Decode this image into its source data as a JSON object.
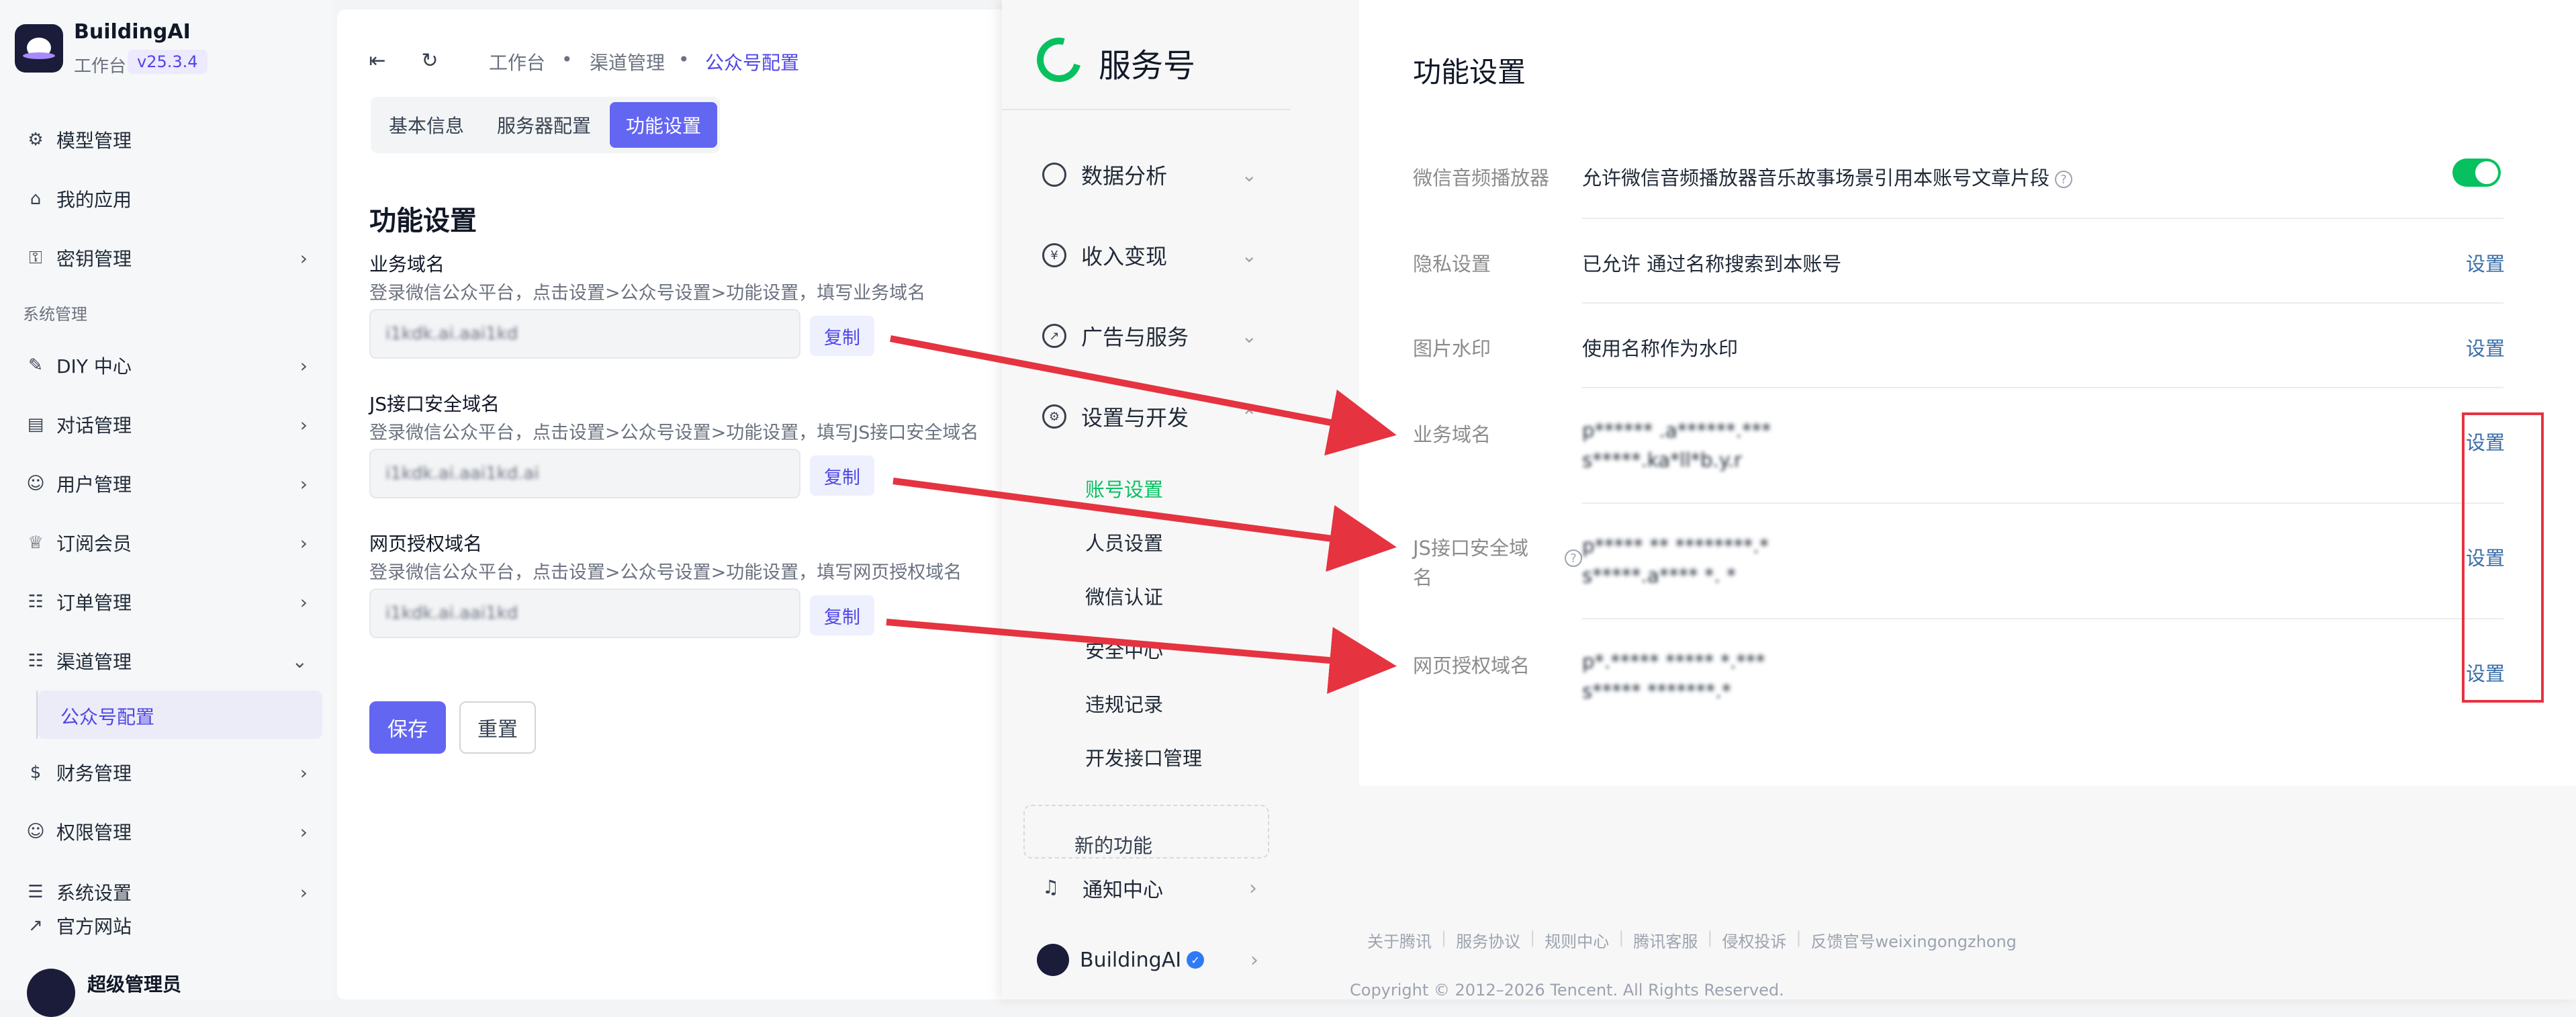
{
  "app": {
    "brand": "BuildingAI",
    "workspace": "工作台",
    "version": "v25.3.4"
  },
  "sidebar": {
    "items": [
      {
        "label": "模型管理",
        "icon": "model-icon"
      },
      {
        "label": "我的应用",
        "icon": "store-icon"
      },
      {
        "label": "密钥管理",
        "icon": "key-icon"
      }
    ],
    "section": "系统管理",
    "system_items": [
      {
        "label": "DIY 中心",
        "icon": "brush-icon"
      },
      {
        "label": "对话管理",
        "icon": "chat-icon"
      },
      {
        "label": "用户管理",
        "icon": "users-icon"
      },
      {
        "label": "订阅会员",
        "icon": "crown-icon"
      },
      {
        "label": "订单管理",
        "icon": "clipboard-icon"
      },
      {
        "label": "渠道管理",
        "icon": "channel-icon"
      }
    ],
    "channel_sub": "公众号配置",
    "more_items": [
      {
        "label": "财务管理",
        "icon": "finance-icon"
      },
      {
        "label": "权限管理",
        "icon": "permission-icon"
      },
      {
        "label": "系统设置",
        "icon": "settings-icon"
      }
    ],
    "website": "官方网站",
    "user": "超级管理员"
  },
  "config": {
    "breadcrumb": [
      "工作台",
      "渠道管理",
      "公众号配置"
    ],
    "tabs": [
      "基本信息",
      "服务器配置",
      "功能设置"
    ],
    "active_tab": "功能设置",
    "title": "功能设置",
    "fields": [
      {
        "label": "业务域名",
        "help": "登录微信公众平台，点击设置>公众号设置>功能设置，填写业务域名",
        "value": "i1kdk.ai.aai1kd"
      },
      {
        "label": "JS接口安全域名",
        "help": "登录微信公众平台，点击设置>公众号设置>功能设置，填写JS接口安全域名",
        "value": "i1kdk.ai.aai1kd.ai"
      },
      {
        "label": "网页授权域名",
        "help": "登录微信公众平台，点击设置>公众号设置>功能设置，填写网页授权域名",
        "value": "i1kdk.ai.aai1kd"
      }
    ],
    "copy_label": "复制",
    "save_label": "保存",
    "reset_label": "重置"
  },
  "wechat": {
    "title": "服务号",
    "menu": [
      {
        "label": "数据分析",
        "icon": "analytics-icon"
      },
      {
        "label": "收入变现",
        "icon": "yen-icon"
      },
      {
        "label": "广告与服务",
        "icon": "compass-icon"
      },
      {
        "label": "设置与开发",
        "icon": "gear-icon"
      }
    ],
    "submenu": [
      "账号设置",
      "人员设置",
      "微信认证",
      "安全中心",
      "违规记录",
      "开发接口管理"
    ],
    "active_sub": "账号设置",
    "new_feature": "新的功能",
    "notify": "通知中心",
    "account": "BuildingAI",
    "content_title": "功能设置",
    "rows": [
      {
        "label": "微信音频播放器",
        "value": "允许微信音频播放器音乐故事场景引用本账号文章片段"
      },
      {
        "label": "隐私设置",
        "value": "已允许 通过名称搜索到本账号",
        "link": "设置"
      },
      {
        "label": "图片水印",
        "value": "使用名称作为水印",
        "link": "设置"
      },
      {
        "label": "业务域名",
        "value1": "p****** .a******.*** ",
        "value2": "s*****.ka*ll*b.y.r",
        "link": "设置"
      },
      {
        "label": "JS接口安全域名",
        "value1": "p***** ** ********.*",
        "value2": "s*****.a**** *. *",
        "link": "设置"
      },
      {
        "label": "网页授权域名",
        "value1": "p*.***** ***** *.***",
        "value2": "s***** *******.*",
        "link": "设置"
      }
    ],
    "audio_toggle": true,
    "footer": [
      "关于腾讯",
      "服务协议",
      "规则中心",
      "腾讯客服",
      "侵权投诉",
      "反馈官号weixingongzhong"
    ],
    "copyright": "Copyright © 2012–2026 Tencent. All Rights Reserved."
  },
  "colors": {
    "accent": "#6366f1",
    "wechat_green": "#07c160",
    "annotation_red": "#e53340"
  }
}
